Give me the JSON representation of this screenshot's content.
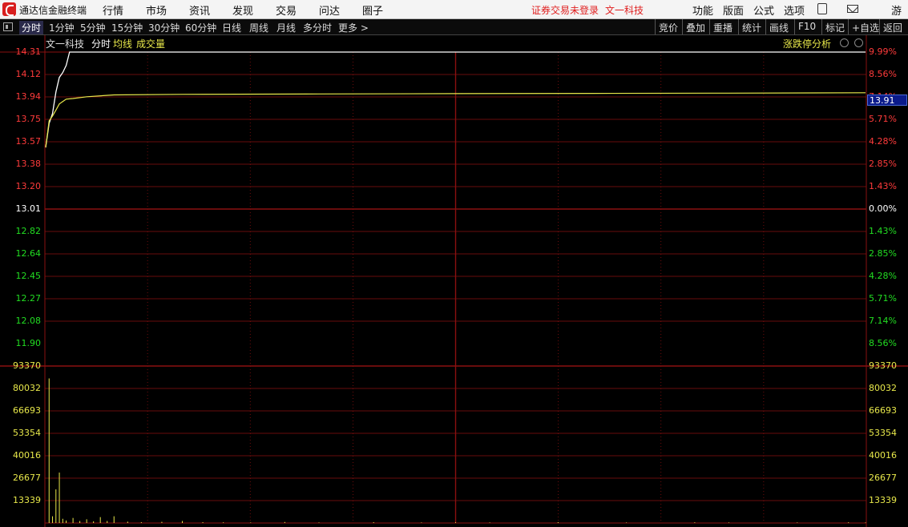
{
  "menubar": {
    "app_name": "通达信金融终端",
    "items": [
      "行情",
      "市场",
      "资讯",
      "发现",
      "交易",
      "问达",
      "圈子"
    ],
    "status_text": "证券交易未登录",
    "stock_name": "文一科技",
    "right_items": [
      "功能",
      "版面",
      "公式",
      "选项"
    ],
    "user_text": "游客"
  },
  "toolbar": {
    "periods": [
      "分时",
      "1分钟",
      "5分钟",
      "15分钟",
      "30分钟",
      "60分钟",
      "日线",
      "周线",
      "月线",
      "多分时",
      "更多 >"
    ],
    "right_buttons": [
      "竞价",
      "叠加",
      "重播",
      "统计",
      "画线",
      "F10",
      "标记",
      "+自选",
      "返回"
    ]
  },
  "chart_header": {
    "stock_name": "文一科技",
    "mode": "分时",
    "avg_label": "均线",
    "volume_label": "成交量",
    "analysis": "涨跌停分析"
  },
  "colors": {
    "up": "#ff3b3b",
    "down": "#22dd22",
    "flat": "#ffffff",
    "price_line": "#ffffff",
    "avg_line": "#e8e84a",
    "grid": "#8a1010",
    "volume": "#e8e84a"
  },
  "chart_data": {
    "type": "line",
    "prev_close": 13.01,
    "current_price": "13.91",
    "price_ticks_up": [
      "14.31",
      "14.12",
      "13.94",
      "13.75",
      "13.57",
      "13.38",
      "13.20"
    ],
    "price_mid": "13.01",
    "price_ticks_down": [
      "12.82",
      "12.64",
      "12.45",
      "12.27",
      "12.08",
      "11.90"
    ],
    "pct_ticks_up": [
      "9.99%",
      "8.56%",
      "7.14%",
      "5.71%",
      "4.28%",
      "2.85%",
      "1.43%"
    ],
    "pct_mid": "0.00%",
    "pct_ticks_down": [
      "1.43%",
      "2.85%",
      "4.28%",
      "5.71%",
      "7.14%",
      "8.56%"
    ],
    "volume_ticks": [
      "93370",
      "80032",
      "66693",
      "53354",
      "40016",
      "26677",
      "13339"
    ],
    "ylim": [
      11.71,
      14.31
    ],
    "volume_max": 93370,
    "price_series": [
      [
        0,
        13.52
      ],
      [
        1,
        13.72
      ],
      [
        2,
        13.8
      ],
      [
        3,
        13.98
      ],
      [
        4,
        14.1
      ],
      [
        5,
        14.14
      ],
      [
        6,
        14.2
      ],
      [
        7,
        14.31
      ],
      [
        8,
        14.31
      ],
      [
        240,
        14.31
      ]
    ],
    "avg_series": [
      [
        0,
        13.52
      ],
      [
        1,
        13.74
      ],
      [
        2,
        13.78
      ],
      [
        3,
        13.83
      ],
      [
        4,
        13.88
      ],
      [
        5,
        13.9
      ],
      [
        6,
        13.92
      ],
      [
        8,
        13.925
      ],
      [
        12,
        13.94
      ],
      [
        20,
        13.955
      ],
      [
        40,
        13.96
      ],
      [
        80,
        13.963
      ],
      [
        120,
        13.966
      ],
      [
        160,
        13.968
      ],
      [
        200,
        13.97
      ],
      [
        240,
        13.973
      ]
    ],
    "volume_series": [
      [
        1,
        86000
      ],
      [
        2,
        4000
      ],
      [
        3,
        20000
      ],
      [
        4,
        30000
      ],
      [
        5,
        2500
      ],
      [
        6,
        1500
      ],
      [
        8,
        3000
      ],
      [
        10,
        1200
      ],
      [
        12,
        2200
      ],
      [
        14,
        1000
      ],
      [
        16,
        3500
      ],
      [
        18,
        1200
      ],
      [
        20,
        4000
      ],
      [
        24,
        800
      ],
      [
        28,
        500
      ],
      [
        34,
        700
      ],
      [
        40,
        1200
      ],
      [
        46,
        500
      ],
      [
        52,
        400
      ],
      [
        60,
        300
      ],
      [
        70,
        600
      ],
      [
        80,
        300
      ],
      [
        96,
        500
      ],
      [
        110,
        300
      ],
      [
        120,
        400
      ],
      [
        130,
        300
      ],
      [
        150,
        500
      ],
      [
        170,
        300
      ],
      [
        190,
        400
      ],
      [
        200,
        300
      ],
      [
        220,
        300
      ],
      [
        235,
        400
      ],
      [
        240,
        300
      ]
    ]
  }
}
